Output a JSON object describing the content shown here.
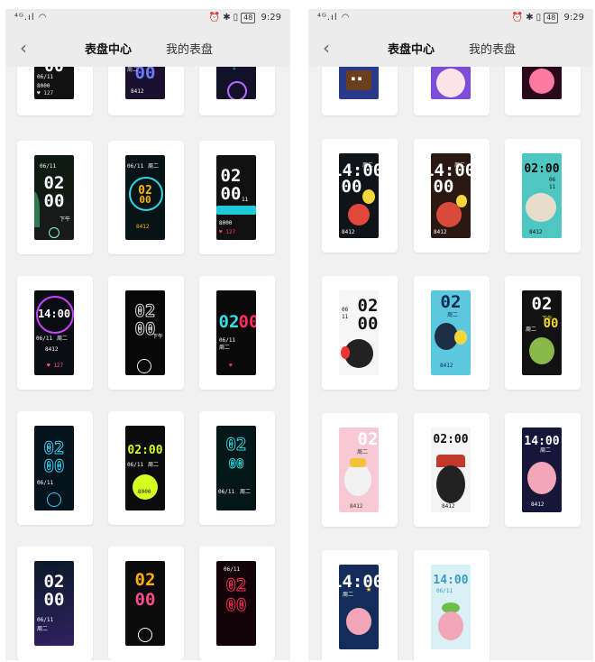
{
  "status_bar": {
    "time": "9:29",
    "battery": "48",
    "signal": "⁴ᴳ.ıl ◠"
  },
  "header": {
    "back_icon": "back-chevron-icon",
    "tab_active": "表盘中心",
    "tab_inactive": "我的表盘"
  },
  "left_faces": [
    {
      "top": "00",
      "big": "00",
      "date": "06/11",
      "weekday": "周二",
      "steps": "8000",
      "heart": "127",
      "alt": "8412",
      "pm": "下午"
    },
    {
      "bg": "#0b0b0b"
    }
  ],
  "right_faces": [
    {
      "big": "14:00",
      "big2": "02:00",
      "big3": "02",
      "big4": "00",
      "date": "06/11",
      "weekday": "周二",
      "pm": "下午",
      "steps": "8412",
      "mon": "06",
      "day": "11"
    }
  ],
  "colors": {
    "phone_bg": "#f1f1f1",
    "header_bg": "#ececec",
    "card_bg": "#ffffff"
  }
}
